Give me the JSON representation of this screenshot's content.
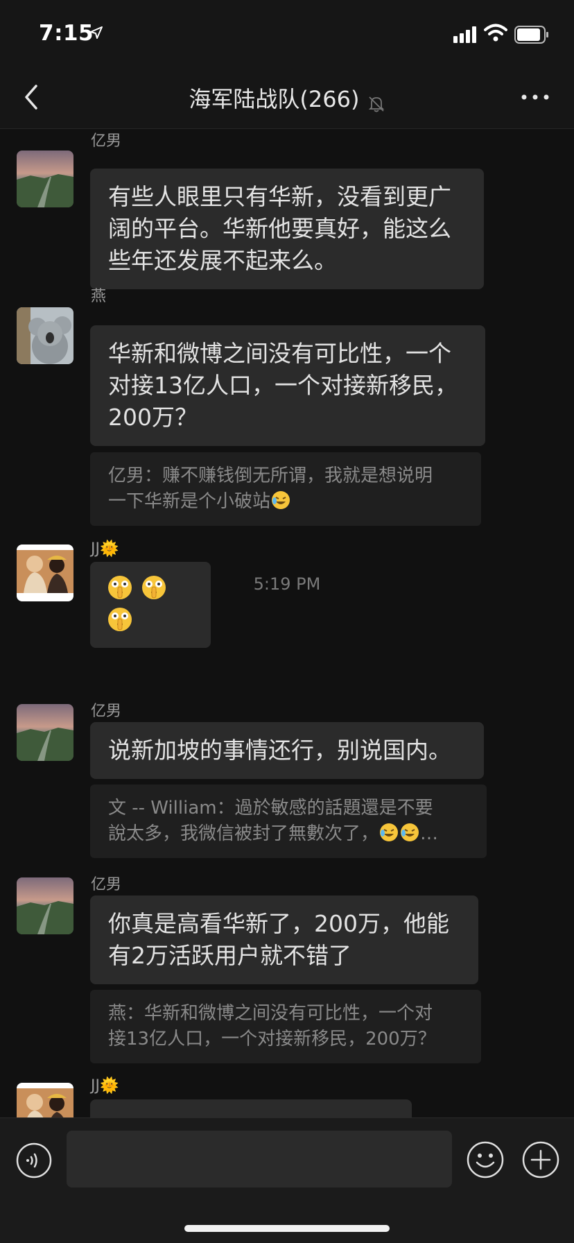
{
  "status_bar": {
    "time": "7:15"
  },
  "nav": {
    "title": "海军陆战队(266)"
  },
  "messages": [
    {
      "sender": "亿男",
      "avatar": "landscape-avatar",
      "text": [
        "有些人眼里只有华新，没看到更广",
        "阔的平台。华新他要真好，能这么",
        "些年还发展不起来么。"
      ]
    },
    {
      "sender": "燕",
      "avatar": "koala-avatar",
      "text": [
        "华新和微博之间没有可比性，一个",
        "对接13亿人口，一个对接新移民，",
        "200万？"
      ],
      "quote": [
        "亿男：赚不赚钱倒无所谓，我就是想说明",
        "一下华新是个小破站"
      ]
    },
    {
      "sender": "JJ",
      "sender_suffix": "🌞",
      "avatar": "people-avatar",
      "emoji_count": 3,
      "emoji_name": "shushing-face-emoji"
    },
    {
      "sender": "亿男",
      "avatar": "landscape-avatar",
      "text": [
        "说新加坡的事情还行，别说国内。"
      ],
      "quote": [
        "文 -- William：過於敏感的話題還是不要",
        "說太多，我微信被封了無數次了，",
        "…"
      ]
    },
    {
      "sender": "亿男",
      "avatar": "landscape-avatar",
      "text": [
        "你真是高看华新了，200万，他能",
        "有2万活跃用户就不错了"
      ],
      "quote": [
        "燕：华新和微博之间没有可比性，一个对",
        "接13亿人口，一个对接新移民，200万？"
      ]
    },
    {
      "sender": "JJ",
      "sender_suffix": "🌞",
      "avatar": "people-avatar"
    }
  ],
  "time_separator": "5:19 PM",
  "input": {
    "value": "",
    "placeholder": ""
  },
  "colors": {
    "background": "#111111",
    "bubble": "#2b2b2b",
    "quote": "#1f1f1f",
    "text": "#e3e3e3",
    "muted": "#9a9a9a"
  }
}
